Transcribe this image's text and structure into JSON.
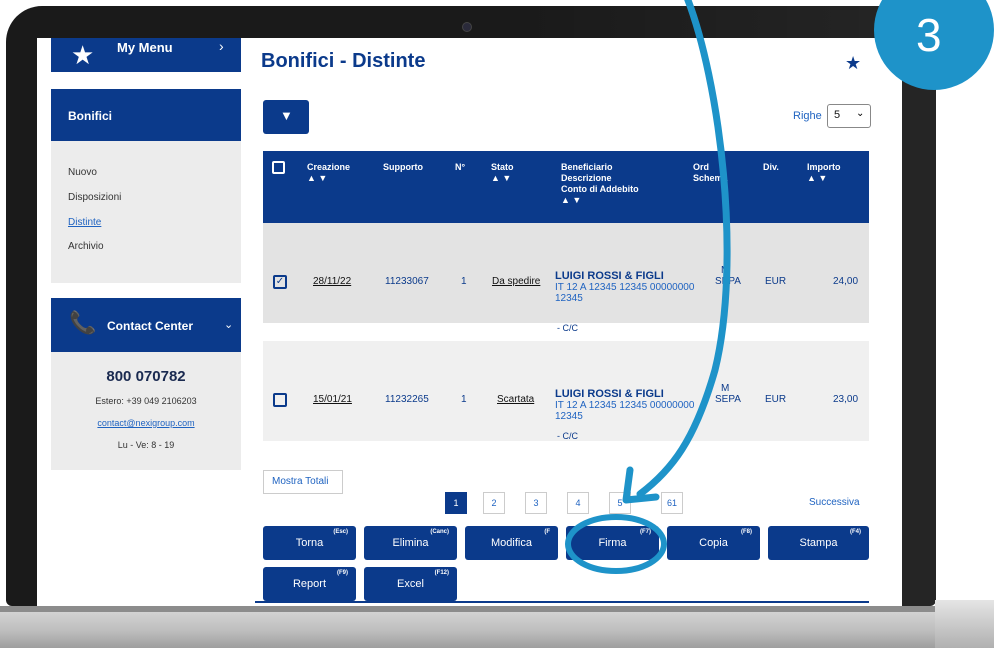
{
  "step": "3",
  "sidebar": {
    "mymenu": {
      "label": "My Menu",
      "chevron": "›"
    },
    "section": {
      "title": "Bonifici",
      "items": [
        {
          "label": "Nuovo",
          "active": false
        },
        {
          "label": "Disposizioni",
          "active": false
        },
        {
          "label": "Distinte",
          "active": true
        },
        {
          "label": "Archivio",
          "active": false
        }
      ]
    },
    "contact": {
      "title": "Contact Center",
      "number": "800 070782",
      "estero": "Estero: +39 049 2106203",
      "email": "contact@nexigroup.com",
      "hours": "Lu - Ve: 8 - 19"
    }
  },
  "page": {
    "title": "Bonifici - Distinte"
  },
  "righe": {
    "label": "Righe",
    "value": "5"
  },
  "table": {
    "headers": {
      "creazione": "Creazione",
      "supporto": "Supporto",
      "n": "N°",
      "stato": "Stato",
      "beneficiario": "Beneficiario",
      "descrizione": "Descrizione",
      "conto": "Conto di Addebito",
      "ord": "Ord",
      "schema": "Schema",
      "div": "Div.",
      "importo": "Importo",
      "sort": "▲ ▼"
    },
    "rows": [
      {
        "selected": true,
        "creazione": "28/11/22",
        "supporto": "11233067",
        "n": "1",
        "stato": "Da spedire",
        "beneficiario": "LUIGI ROSSI & FIGLI",
        "iban": "IT 12 A 12345 12345 00000000",
        "iban2": "12345",
        "conto": "- C/C",
        "ord": "M",
        "schema": "SEPA",
        "div": "EUR",
        "importo": "24,00"
      },
      {
        "selected": false,
        "creazione": "15/01/21",
        "supporto": "11232265",
        "n": "1",
        "stato": "Scartata",
        "beneficiario": "LUIGI ROSSI & FIGLI",
        "iban": "IT 12 A 12345 12345 00000000",
        "iban2": "12345",
        "conto": "- C/C",
        "ord": "M",
        "schema": "SEPA",
        "div": "EUR",
        "importo": "23,00"
      }
    ]
  },
  "mostra_totali": "Mostra Totali",
  "pagination": {
    "pages": [
      "1",
      "2",
      "3",
      "4",
      "5",
      "61"
    ],
    "active": "1",
    "next": "Successiva"
  },
  "buttons": {
    "torna": {
      "label": "Torna",
      "key": "(Esc)"
    },
    "elimina": {
      "label": "Elimina",
      "key": "(Canc)"
    },
    "modifica": {
      "label": "Modifica",
      "key": "(F"
    },
    "firma": {
      "label": "Firma",
      "key": "(F7)"
    },
    "copia": {
      "label": "Copia",
      "key": "(F8)"
    },
    "stampa": {
      "label": "Stampa",
      "key": "(F4)"
    },
    "report": {
      "label": "Report",
      "key": "(F9)"
    },
    "excel": {
      "label": "Excel",
      "key": "(F12)"
    }
  },
  "colors": {
    "navy": "#0b3a8b",
    "link": "#1f63c1",
    "accent": "#1e93c9"
  },
  "icons": {
    "mymenu": "star-icon",
    "favorite": "star-icon",
    "filter": "filter-icon",
    "contact": "phone-icon",
    "select": "chevron-down-icon",
    "annotation": "arrow-icon"
  }
}
